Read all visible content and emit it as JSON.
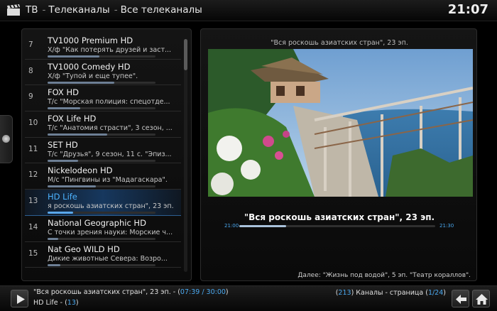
{
  "header": {
    "app_title": "ТВ",
    "crumb1": "Телеканалы",
    "crumb2": "Все телеканалы",
    "clock": "21:07",
    "clapper_icon": "clapperboard-icon"
  },
  "channels": [
    {
      "num": "7",
      "name": "TV1000 Premium HD",
      "program": "Х/ф \"Как потерять друзей и заст...",
      "progress": 0.48
    },
    {
      "num": "8",
      "name": "TV1000 Comedy HD",
      "program": "Х/ф \"Тупой и еще тупее\".",
      "progress": 0.62
    },
    {
      "num": "9",
      "name": "FOX HD",
      "program": "Т/с \"Морская полиция: спецотде...",
      "progress": 0.3
    },
    {
      "num": "10",
      "name": "FOX Life HD",
      "program": "Т/с \"Анатомия страсти\", 3 сезон, ...",
      "progress": 0.55
    },
    {
      "num": "11",
      "name": "SET HD",
      "program": "Т/с \"Друзья\", 9 сезон, 11 с. \"Эпиз...",
      "progress": 0.28
    },
    {
      "num": "12",
      "name": "Nickelodeon HD",
      "program": "М/с \"Пингвины из \"Мадагаскара\".",
      "progress": 0.45
    },
    {
      "num": "13",
      "name": "HD Life",
      "program": "я роскошь азиатских стран\", 23 эп.",
      "progress": 0.24,
      "selected": true
    },
    {
      "num": "14",
      "name": "National Geographic HD",
      "program": "С точки зрения науки: Морские ч...",
      "progress": 0.1
    },
    {
      "num": "15",
      "name": "Nat Geo WILD HD",
      "program": "Дикие животные Севера: Возро...",
      "progress": 0.12
    }
  ],
  "scroll_position": 0,
  "preview": {
    "video_title": "\"Вся роскошь азиатских стран\", 23 эп.",
    "show_title": "\"Вся роскошь азиатских стран\", 23 эп.",
    "start_time": "21:00",
    "end_time": "21:30",
    "progress": 0.24,
    "next_up": "Далее: \"Жизнь под водой\", 5 эп. \"Театр кораллов\"."
  },
  "footer": {
    "line1_text": "\"Вся роскошь азиатских стран\", 23 эп. - (",
    "line1_time": "07:39 / 30:00",
    "line1_close": ")",
    "line2_text": "HD Life - (",
    "line2_num": "13",
    "line2_close": ")",
    "page_open": "(",
    "page_count": "213",
    "page_mid": ") Каналы - страница (",
    "page_cur": "1/24",
    "page_close": ")"
  },
  "icons": {
    "play": "play-icon",
    "back": "back-arrow-icon",
    "home": "home-icon",
    "side": "side-menu-handle-icon"
  },
  "colors": {
    "accent": "#4aa8ef",
    "selected_row": "#2d5f92",
    "background": "#000000"
  }
}
